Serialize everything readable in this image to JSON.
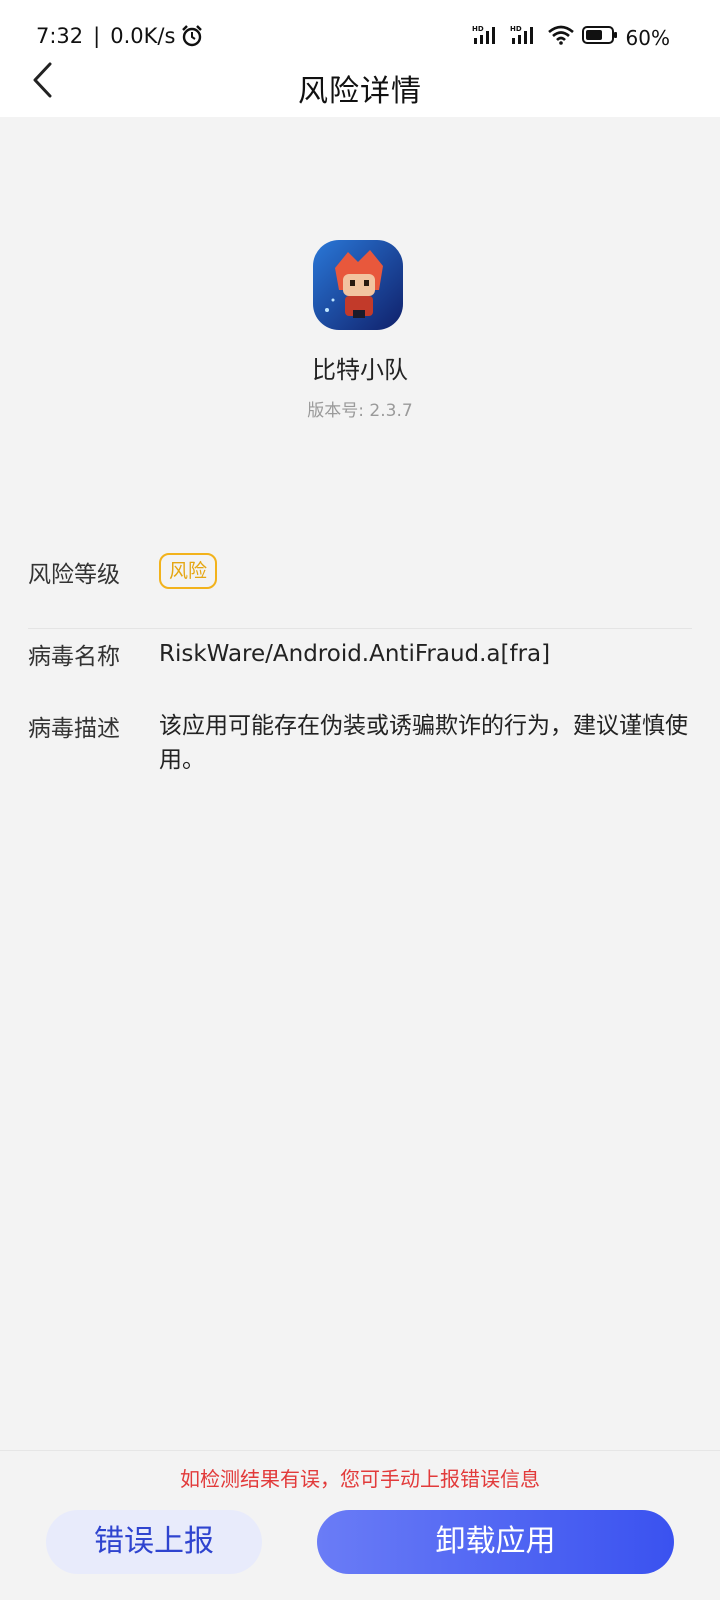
{
  "status_bar": {
    "time": "7:32",
    "separator": "|",
    "net_speed": "0.0K/s",
    "battery": "60%"
  },
  "header": {
    "title": "风险详情"
  },
  "app": {
    "name": "比特小队",
    "version": "版本号: 2.3.7"
  },
  "details": {
    "risk_level_label": "风险等级",
    "risk_level_value": "风险",
    "virus_name_label": "病毒名称",
    "virus_name_value": "RiskWare/Android.AntiFraud.a[fra]",
    "virus_desc_label": "病毒描述",
    "virus_desc_value": "该应用可能存在伪装或诱骗欺诈的行为，建议谨慎使用。"
  },
  "bottom": {
    "hint": "如检测结果有误，您可手动上报错误信息",
    "report_button": "错误上报",
    "uninstall_button": "卸载应用"
  },
  "colors": {
    "accent": "#3a52f0",
    "warning": "#f2b21b",
    "hint_red": "#e23a3a"
  }
}
